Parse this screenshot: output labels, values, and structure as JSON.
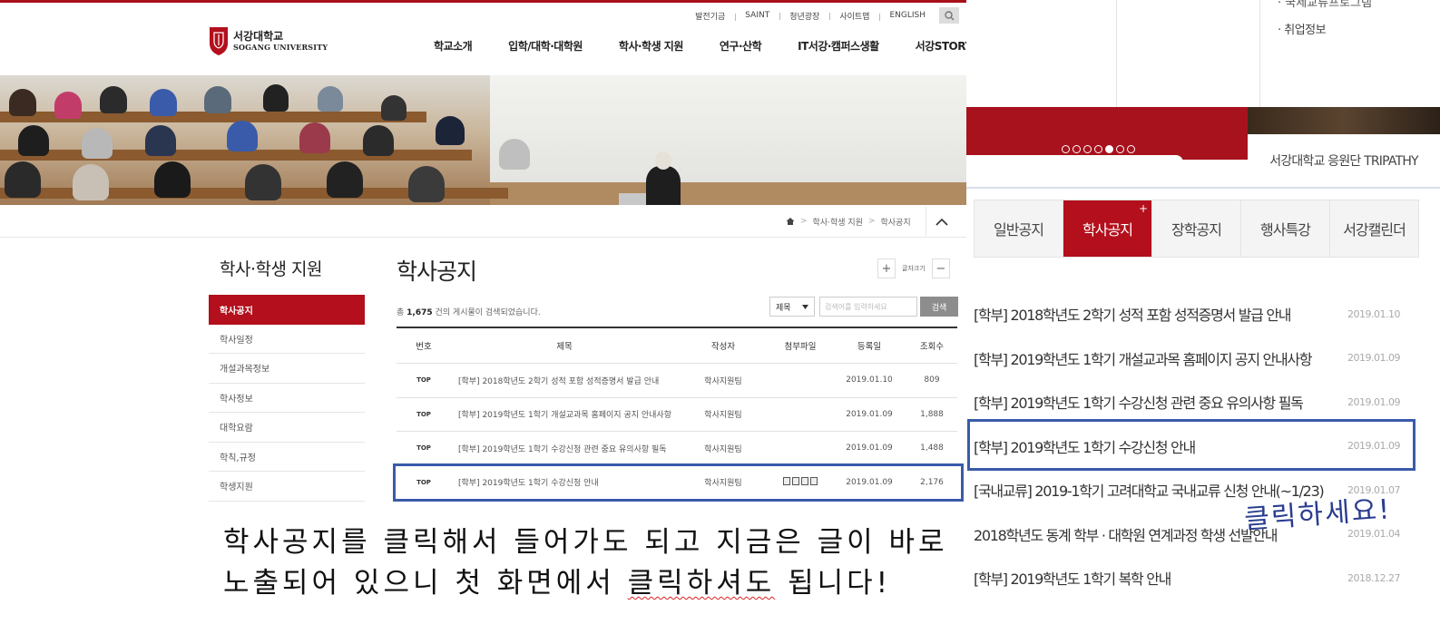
{
  "left": {
    "util_links": [
      "발전기금",
      "SAINT",
      "청년광장",
      "사이트맵",
      "ENGLISH"
    ],
    "logo": {
      "line1": "서강대학교",
      "line2": "SOGANG UNIVERSITY"
    },
    "gnb": [
      "학교소개",
      "입학/대학·대학원",
      "학사·학생 지원",
      "연구·산학",
      "IT서강·캠퍼스생활",
      "서강STORY"
    ],
    "breadcrumb": [
      "학사·학생 지원",
      "학사공지"
    ],
    "lnb_title": "학사·학생 지원",
    "lnb_items": [
      "학사공지",
      "학사일정",
      "개설과목정보",
      "학사정보",
      "대학요람",
      "학칙,규정",
      "학생지원"
    ],
    "page_title": "학사공지",
    "font_size_label": "글자크기",
    "count": {
      "prefix": "총",
      "value": "1,675",
      "suffix": "건의 게시물이 검색되었습니다."
    },
    "search": {
      "select_value": "제목",
      "placeholder": "검색어를 입력하세요",
      "button": "검색"
    },
    "table": {
      "headers": [
        "번호",
        "제목",
        "작성자",
        "첨부파일",
        "등록일",
        "조회수"
      ],
      "rows": [
        {
          "no": "TOP",
          "title": "[학부] 2018학년도 2학기 성적 포함 성적증명서 발급 안내",
          "author": "학사지원팀",
          "date": "2019.01.10",
          "views": "809"
        },
        {
          "no": "TOP",
          "title": "[학부] 2019학년도 1학기 개설교과목 홈페이지 공지 안내사항",
          "author": "학사지원팀",
          "date": "2019.01.09",
          "views": "1,888"
        },
        {
          "no": "TOP",
          "title": "[학부] 2019학년도 1학기 수강신청 관련 중요 유의사항 필독",
          "author": "학사지원팀",
          "date": "2019.01.09",
          "views": "1,488"
        },
        {
          "no": "TOP",
          "title": "[학부] 2019학년도 1학기 수강신청 안내",
          "author": "학사지원팀",
          "date": "2019.01.09",
          "views": "2,176"
        }
      ]
    },
    "note": {
      "line1": "학사공지를 클릭해서 들어가도 되고 지금은 글이 바로",
      "line2a": "노출되어 있으니 첫 화면에서 ",
      "line2b": "클릭하셔도",
      "line2c": " 됩니다!"
    }
  },
  "right": {
    "top_item": "· 취업정보",
    "top_item_cut": "· 국제교류프로그램",
    "cheer_banner": "서강대학교 응원단 TRIPATHY",
    "tabs": [
      "일반공지",
      "학사공지",
      "장학공지",
      "행사특강",
      "서강캘린더"
    ],
    "list": [
      {
        "title": "[학부] 2018학년도 2학기 성적 포함 성적증명서 발급 안내",
        "date": "2019.01.10"
      },
      {
        "title": "[학부] 2019학년도 1학기 개설교과목 홈페이지 공지 안내사항",
        "date": "2019.01.09"
      },
      {
        "title": "[학부] 2019학년도 1학기 수강신청 관련 중요 유의사항 필독",
        "date": "2019.01.09"
      },
      {
        "title": "[학부] 2019학년도 1학기 수강신청 안내",
        "date": "2019.01.09"
      },
      {
        "title": "[국내교류] 2019-1학기 고려대학교 국내교류 신청 안내(~1/23)",
        "date": "2019.01.07"
      },
      {
        "title": "2018학년도 동계 학부 · 대학원 연계과정 학생 선발안내",
        "date": "2019.01.04"
      },
      {
        "title": "[학부] 2019학년도 1학기 복학 안내",
        "date": "2018.12.27"
      }
    ],
    "click_note": "클릭하세요!"
  },
  "colors": {
    "brand_red": "#b30f1c",
    "highlight_blue": "#3a5ba9"
  },
  "icons": [
    "search-icon",
    "home-icon",
    "chevron-up-icon",
    "plus-icon",
    "minus-icon",
    "attachment-icon"
  ]
}
